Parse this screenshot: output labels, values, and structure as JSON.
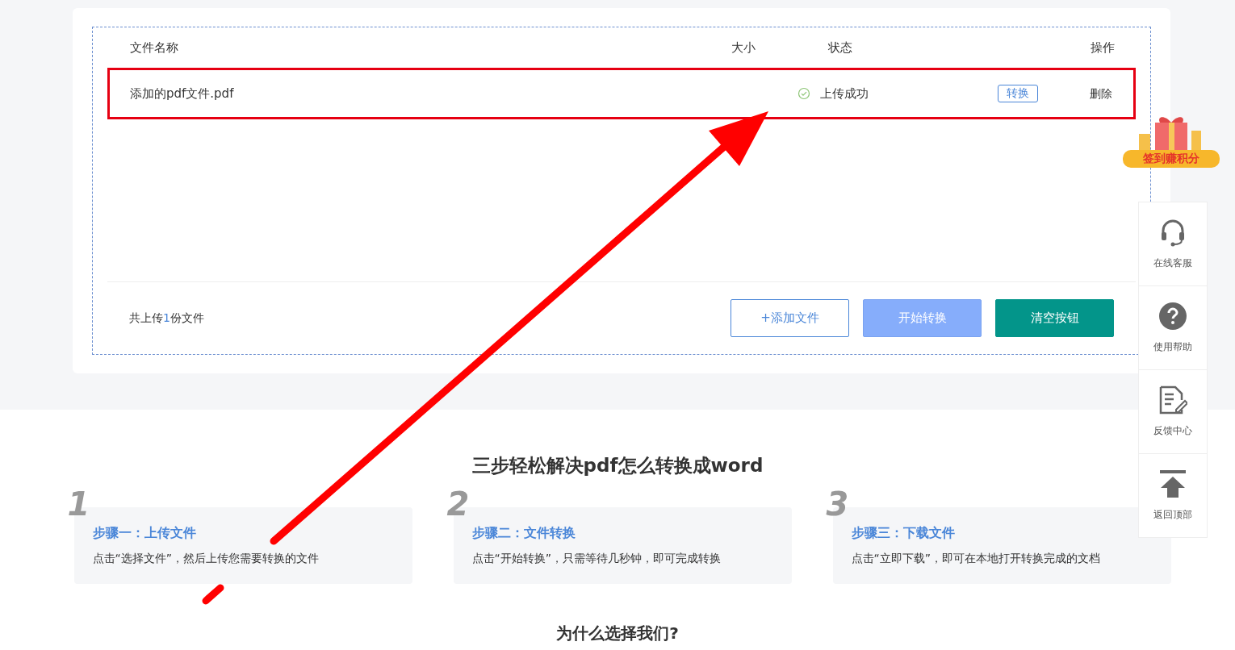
{
  "table": {
    "columns": [
      {
        "label": "文件名称"
      },
      {
        "label": "大小"
      },
      {
        "label": "状态"
      },
      {
        "label": "操作"
      }
    ],
    "rows": [
      {
        "name": "添加的pdf文件.pdf",
        "status": "上传成功",
        "status_ok": true,
        "convert": "转换",
        "delete": "删除",
        "highlighted": true
      }
    ]
  },
  "footer": {
    "count_prefix": "共上传",
    "count": "1",
    "count_suffix": "份文件",
    "buttons": [
      {
        "label": "+添加文件",
        "kind": "outline"
      },
      {
        "label": "开始转换",
        "kind": "light"
      },
      {
        "label": "清空按钮",
        "kind": "solid"
      }
    ]
  },
  "badge": {
    "label": "签到赚积分"
  },
  "side_menu": [
    {
      "label": "在线客服",
      "kind": "headset"
    },
    {
      "label": "使用帮助",
      "kind": "help"
    },
    {
      "label": "反馈中心",
      "kind": "feedback"
    },
    {
      "label": "返回顶部",
      "kind": "top"
    }
  ],
  "steps_title": "三步轻松解决pdf怎么转换成word",
  "steps": [
    {
      "number": "1",
      "title": "步骤一：上传文件",
      "text": "点击“选择文件”，然后上传您需要转换的文件"
    },
    {
      "number": "2",
      "title": "步骤二：文件转换",
      "text": "点击“开始转换”，只需等待几秒钟，即可完成转换"
    },
    {
      "number": "3",
      "title": "步骤三：下载文件",
      "text": "点击“立即下载”，即可在本地打开转换完成的文档"
    }
  ],
  "next_title": "为什么选择我们?",
  "annotation": {
    "arrow": true
  }
}
